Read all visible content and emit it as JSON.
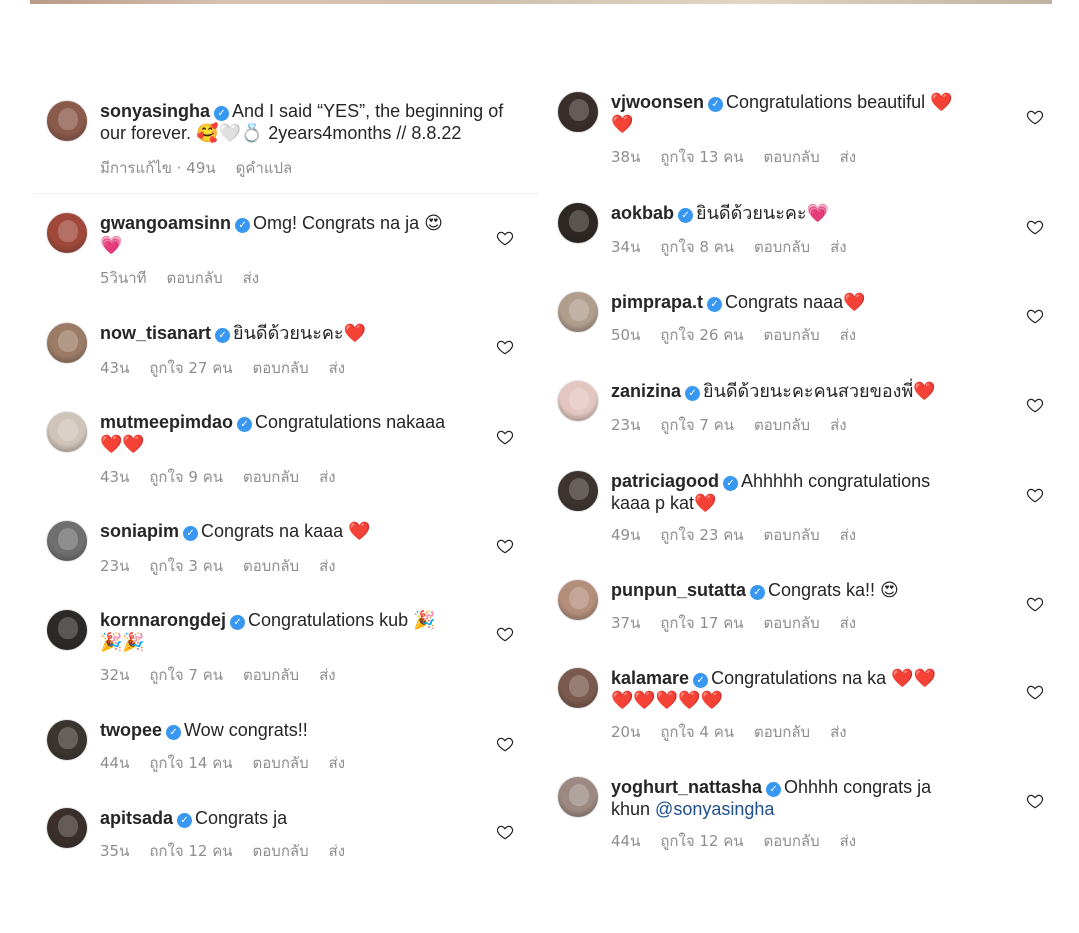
{
  "left_column": [
    {
      "username": "sonyasingha",
      "text_line1": "And I said “YES”, the beginning of",
      "text_line2": "our forever. 🥰🤍💍 2years4months // 8.8.22",
      "time": "มีการแก้ไข · 49น",
      "likes": "",
      "reply": "ดูคำแปล",
      "send": "",
      "avatar_color": "#8a5a4a",
      "has_like": false
    },
    {
      "username": "gwangoamsinn",
      "text_line1": "Omg! Congrats na ja 😍",
      "text_line2": "💗",
      "time": "5วินาที",
      "likes": "",
      "reply": "ตอบกลับ",
      "send": "ส่ง",
      "avatar_color": "#a0483a",
      "has_like": true
    },
    {
      "username": "now_tisanart",
      "text_line1": "ยินดีด้วยนะคะ❤️",
      "text_line2": "",
      "time": "43น",
      "likes": "ถูกใจ 27 คน",
      "reply": "ตอบกลับ",
      "send": "ส่ง",
      "avatar_color": "#9b7b66",
      "has_like": true
    },
    {
      "username": "mutmeepimdao",
      "text_line1": "Congratulations nakaaa",
      "text_line2": "❤️❤️",
      "time": "43น",
      "likes": "ถูกใจ 9 คน",
      "reply": "ตอบกลับ",
      "send": "ส่ง",
      "avatar_color": "#cfc4b8",
      "has_like": true
    },
    {
      "username": "soniapim",
      "text_line1": "Congrats na kaaa ❤️",
      "text_line2": "",
      "time": "23น",
      "likes": "ถูกใจ 3 คน",
      "reply": "ตอบกลับ",
      "send": "ส่ง",
      "avatar_color": "#6f6f6f",
      "has_like": true
    },
    {
      "username": "kornnarongdej",
      "text_line1": "Congratulations kub 🎉",
      "text_line2": "🎉🎉",
      "time": "32น",
      "likes": "ถูกใจ 7 คน",
      "reply": "ตอบกลับ",
      "send": "ส่ง",
      "avatar_color": "#2b2a28",
      "has_like": true
    },
    {
      "username": "twopee",
      "text_line1": "Wow congrats!!",
      "text_line2": "",
      "time": "44น",
      "likes": "ถูกใจ 14 คน",
      "reply": "ตอบกลับ",
      "send": "ส่ง",
      "avatar_color": "#3b352f",
      "has_like": true
    },
    {
      "username": "apitsada",
      "text_line1": "Congrats ja",
      "text_line2": "",
      "time": "35น",
      "likes": "ถกใจ 12 คน",
      "reply": "ตอบกลับ",
      "send": "ส่ง",
      "avatar_color": "#3a2f2b",
      "has_like": true
    }
  ],
  "right_column": [
    {
      "username": "vjwoonsen",
      "text_line1": "Congratulations beautiful ❤️",
      "text_line2": "❤️",
      "time": "38น",
      "likes": "ถูกใจ 13 คน",
      "reply": "ตอบกลับ",
      "send": "ส่ง",
      "avatar_color": "#3a2e2a",
      "has_like": true
    },
    {
      "username": "aokbab",
      "text_line1": "ยินดีด้วยนะคะ💗",
      "text_line2": "",
      "time": "34น",
      "likes": "ถูกใจ 8 คน",
      "reply": "ตอบกลับ",
      "send": "ส่ง",
      "avatar_color": "#2e2622",
      "has_like": true
    },
    {
      "username": "pimprapa.t",
      "text_line1": "Congrats naaa❤️",
      "text_line2": "",
      "time": "50น",
      "likes": "ถูกใจ 26 คน",
      "reply": "ตอบกลับ",
      "send": "ส่ง",
      "avatar_color": "#b09d8c",
      "has_like": true
    },
    {
      "username": "zanizina",
      "text_line1": "ยินดีด้วยนะคะคนสวยของพี่❤️",
      "text_line2": "",
      "time": "23น",
      "likes": "ถูกใจ 7 คน",
      "reply": "ตอบกลับ",
      "send": "ส่ง",
      "avatar_color": "#e3c6c0",
      "has_like": true
    },
    {
      "username": "patriciagood",
      "text_line1": "Ahhhhh congratulations",
      "text_line2": "kaaa p kat❤️",
      "time": "49น",
      "likes": "ถูกใจ 23 คน",
      "reply": "ตอบกลับ",
      "send": "ส่ง",
      "avatar_color": "#3d3430",
      "has_like": true
    },
    {
      "username": "punpun_sutatta",
      "text_line1": "Congrats ka!! 😍",
      "text_line2": "",
      "time": "37น",
      "likes": "ถูกใจ 17 คน",
      "reply": "ตอบกลับ",
      "send": "ส่ง",
      "avatar_color": "#b38e7a",
      "has_like": true
    },
    {
      "username": "kalamare",
      "text_line1": "Congratulations na ka ❤️❤️",
      "text_line2": "❤️❤️❤️❤️❤️",
      "time": "20น",
      "likes": "ถูกใจ 4 คน",
      "reply": "ตอบกลับ",
      "send": "ส่ง",
      "avatar_color": "#7a5a4c",
      "has_like": true
    },
    {
      "username": "yoghurt_nattasha",
      "text_line1": "Ohhhh congrats ja",
      "text_line2": "khun ",
      "mention": "@sonyasingha",
      "time": "44น",
      "likes": "ถูกใจ 12 คน",
      "reply": "ตอบกลับ",
      "send": "ส่ง",
      "avatar_color": "#9c8a82",
      "has_like": true
    }
  ]
}
